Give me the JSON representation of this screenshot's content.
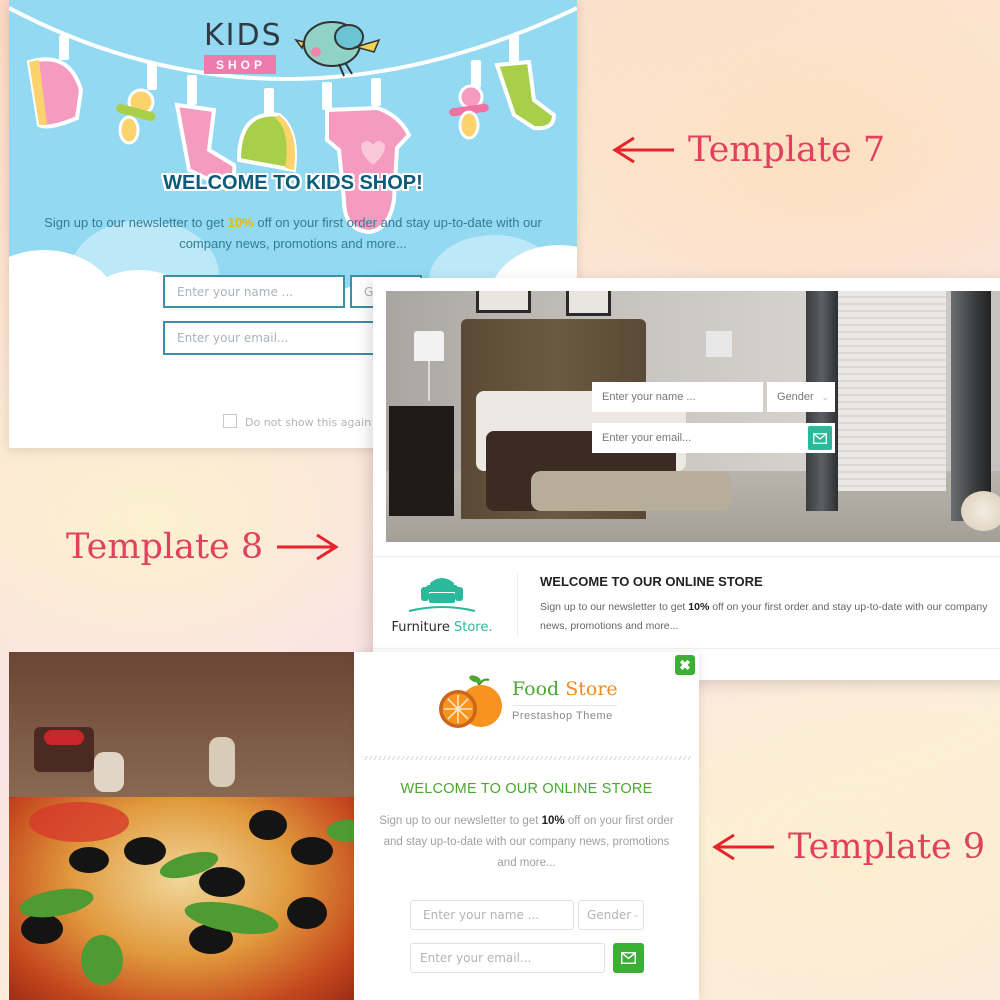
{
  "labels": {
    "template7": "Template 7",
    "template8": "Template 8",
    "template9": "Template 9",
    "arrow_color": "#e8232b",
    "label_color": "#e0415e"
  },
  "template7": {
    "logo_top": "KIDS",
    "logo_bottom": "SHOP",
    "title": "WELCOME TO KIDS SHOP!",
    "desc_before": "Sign up to our newsletter to get ",
    "desc_highlight": "10%",
    "desc_after": " off on your first order and stay up-to-date with our company news, promotions and more...",
    "name_placeholder": "Enter your name ...",
    "gender_placeholder": "Ge",
    "email_placeholder": "Enter your email...",
    "checkbox_label": "Do not show this again",
    "colors": {
      "sky": "#93d9f2",
      "title": "#0d5b7a",
      "accent": "#f4b400",
      "border": "#3b8fa6",
      "pink": "#ee7bae"
    }
  },
  "template8": {
    "name_placeholder": "Enter your name ...",
    "gender_placeholder": "Gender",
    "email_placeholder": "Enter your email...",
    "logo_text_dark": "Furniture",
    "logo_text_accent": " Store.",
    "title": "WELCOME TO OUR ONLINE STORE",
    "desc_before": "Sign up to our newsletter to get ",
    "desc_highlight": "10%",
    "desc_after": " off on your first order and stay up-to-date with our company news, promotions and more...",
    "colors": {
      "accent": "#2ab99a"
    }
  },
  "template9": {
    "brand_green": "Food",
    "brand_orange": " Store",
    "brand_sub": "Prestashop Theme",
    "title": "WELCOME TO OUR ONLINE STORE",
    "desc_before": "Sign up to our newsletter to get ",
    "desc_highlight": "10%",
    "desc_after": " off on your first order and stay up-to-date with our company news, promotions and more...",
    "name_placeholder": "Enter your name ...",
    "gender_placeholder": "Gender",
    "email_placeholder": "Enter your email...",
    "close_glyph": "✖",
    "colors": {
      "green": "#3cb034",
      "orange": "#f08c1e"
    }
  }
}
